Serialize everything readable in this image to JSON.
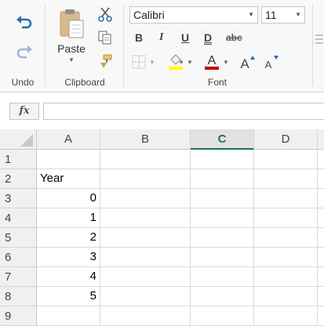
{
  "ribbon": {
    "undo_group_label": "Undo",
    "clipboard_group_label": "Clipboard",
    "font_group_label": "Font",
    "paste_label": "Paste",
    "font_name": "Calibri",
    "font_size": "11",
    "font_color": "#c00000",
    "highlight_color": "#ffff00",
    "icons": [
      "undo-icon",
      "redo-icon",
      "paste-icon",
      "cut-icon",
      "copy-icon",
      "format-painter-icon",
      "bold-icon",
      "italic-icon",
      "underline-icon",
      "double-underline-icon",
      "strikethrough-icon",
      "borders-icon",
      "fill-color-icon",
      "font-color-icon",
      "increase-font-icon",
      "decrease-font-icon"
    ]
  },
  "formula_bar": {
    "fx_label": "fx",
    "value": ""
  },
  "sheet": {
    "columns": [
      "A",
      "B",
      "C",
      "D"
    ],
    "selected_column": "C",
    "rows": [
      "1",
      "2",
      "3",
      "4",
      "5",
      "6",
      "7",
      "8",
      "9"
    ],
    "cells": {
      "A2": "Year",
      "A3": "0",
      "A4": "1",
      "A5": "2",
      "A6": "3",
      "A7": "4",
      "A8": "5"
    }
  }
}
